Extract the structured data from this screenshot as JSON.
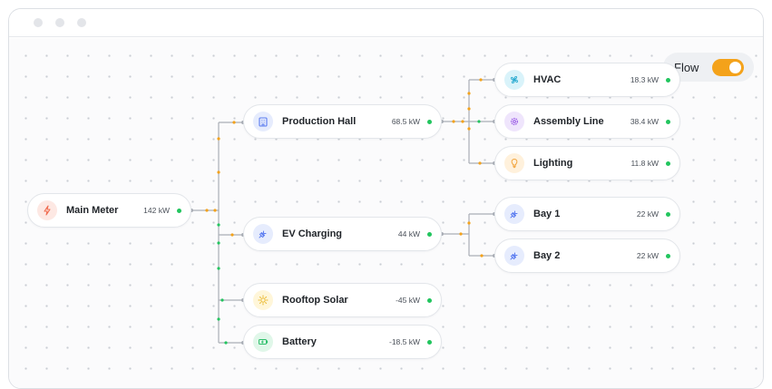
{
  "window": {
    "controls": [
      "close",
      "minimize",
      "maximize"
    ]
  },
  "flow_toggle": {
    "label": "Flow",
    "enabled": true,
    "accent_color": "#f4a21a"
  },
  "nodes": {
    "main_meter": {
      "label": "Main Meter",
      "value": "142 kW",
      "icon": "bolt-icon",
      "status": "online"
    },
    "production_hall": {
      "label": "Production Hall",
      "value": "68.5 kW",
      "icon": "building-icon",
      "status": "online"
    },
    "ev_charging": {
      "label": "EV Charging",
      "value": "44 kW",
      "icon": "plug-icon",
      "status": "online"
    },
    "rooftop_solar": {
      "label": "Rooftop Solar",
      "value": "-45 kW",
      "icon": "sun-icon",
      "status": "online"
    },
    "battery": {
      "label": "Battery",
      "value": "-18.5 kW",
      "icon": "battery-icon",
      "status": "online"
    },
    "hvac": {
      "label": "HVAC",
      "value": "18.3 kW",
      "icon": "fan-icon",
      "status": "online"
    },
    "assembly_line": {
      "label": "Assembly Line",
      "value": "38.4 kW",
      "icon": "gear-icon",
      "status": "online"
    },
    "lighting": {
      "label": "Lighting",
      "value": "11.8 kW",
      "icon": "bulb-icon",
      "status": "online"
    },
    "bay1": {
      "label": "Bay 1",
      "value": "22 kW",
      "icon": "plug-icon",
      "status": "online"
    },
    "bay2": {
      "label": "Bay 2",
      "value": "22 kW",
      "icon": "plug-icon",
      "status": "online"
    }
  },
  "colors": {
    "status_online": "#22c55e",
    "flow_consume": "#f4a21a",
    "flow_produce": "#22c55e",
    "edge": "#a9aeb6"
  }
}
